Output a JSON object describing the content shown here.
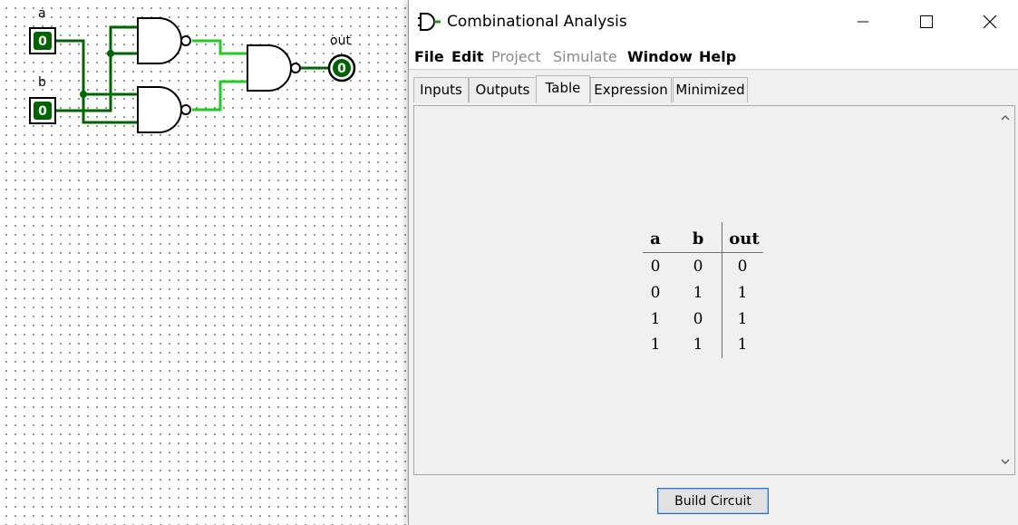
{
  "canvas": {
    "pins": {
      "a_label": "a",
      "b_label": "b",
      "out_label": "out",
      "a_value": "0",
      "b_value": "0",
      "out_value": "0"
    },
    "colors": {
      "wire_dark": "#006400",
      "wire_bright": "#22cc22",
      "pin_bg": "#006400"
    }
  },
  "window": {
    "title": "Combinational Analysis",
    "icon": "logisim-gate-icon",
    "controls": [
      "minimize-icon",
      "maximize-icon",
      "close-icon"
    ]
  },
  "menubar": {
    "items": [
      {
        "label": "File",
        "enabled": true
      },
      {
        "label": "Edit",
        "enabled": true
      },
      {
        "label": "Project",
        "enabled": false
      },
      {
        "label": "Simulate",
        "enabled": false
      },
      {
        "label": "Window",
        "enabled": true
      },
      {
        "label": "Help",
        "enabled": true
      }
    ]
  },
  "tabs": [
    {
      "label": "Inputs"
    },
    {
      "label": "Outputs"
    },
    {
      "label": "Table",
      "selected": true
    },
    {
      "label": "Expression"
    },
    {
      "label": "Minimized"
    }
  ],
  "truth_table": {
    "headers": [
      "a",
      "b",
      "out"
    ],
    "rows": [
      [
        "0",
        "0",
        "0"
      ],
      [
        "0",
        "1",
        "1"
      ],
      [
        "1",
        "0",
        "1"
      ],
      [
        "1",
        "1",
        "1"
      ]
    ]
  },
  "build_button": {
    "label": "Build Circuit"
  }
}
